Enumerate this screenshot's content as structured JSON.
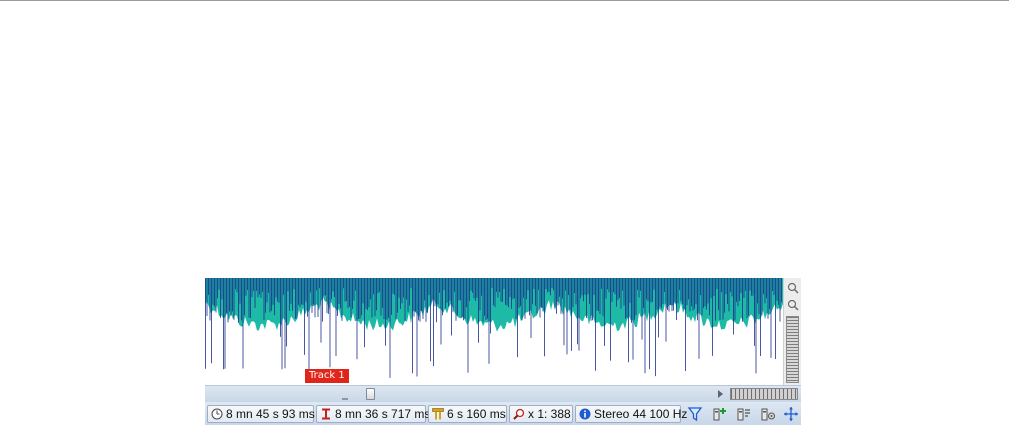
{
  "track": {
    "label": "Track 1"
  },
  "status": {
    "duration": "8 mn 45 s 93 ms",
    "cursor_position": "8 mn 36 s 717 ms",
    "selection_length": "6 s 160 ms",
    "zoom": "x 1: 388",
    "format": "Stereo 44 100 Hz"
  },
  "icons": {
    "duration": "clock-icon",
    "cursor": "cursor-marker-icon",
    "selection": "selection-length-icon",
    "zoom": "magnifier-icon",
    "format": "info-icon",
    "tools": [
      "filter-icon",
      "add-marker-icon",
      "marker-list-icon",
      "marker-settings-icon",
      "move-icon"
    ]
  },
  "colors": {
    "waveform_envelope": "#1dbaa6",
    "waveform_peaks": "#1b2f8c",
    "track_label_bg": "#e2251b",
    "statusbar": "#d3dfed"
  }
}
